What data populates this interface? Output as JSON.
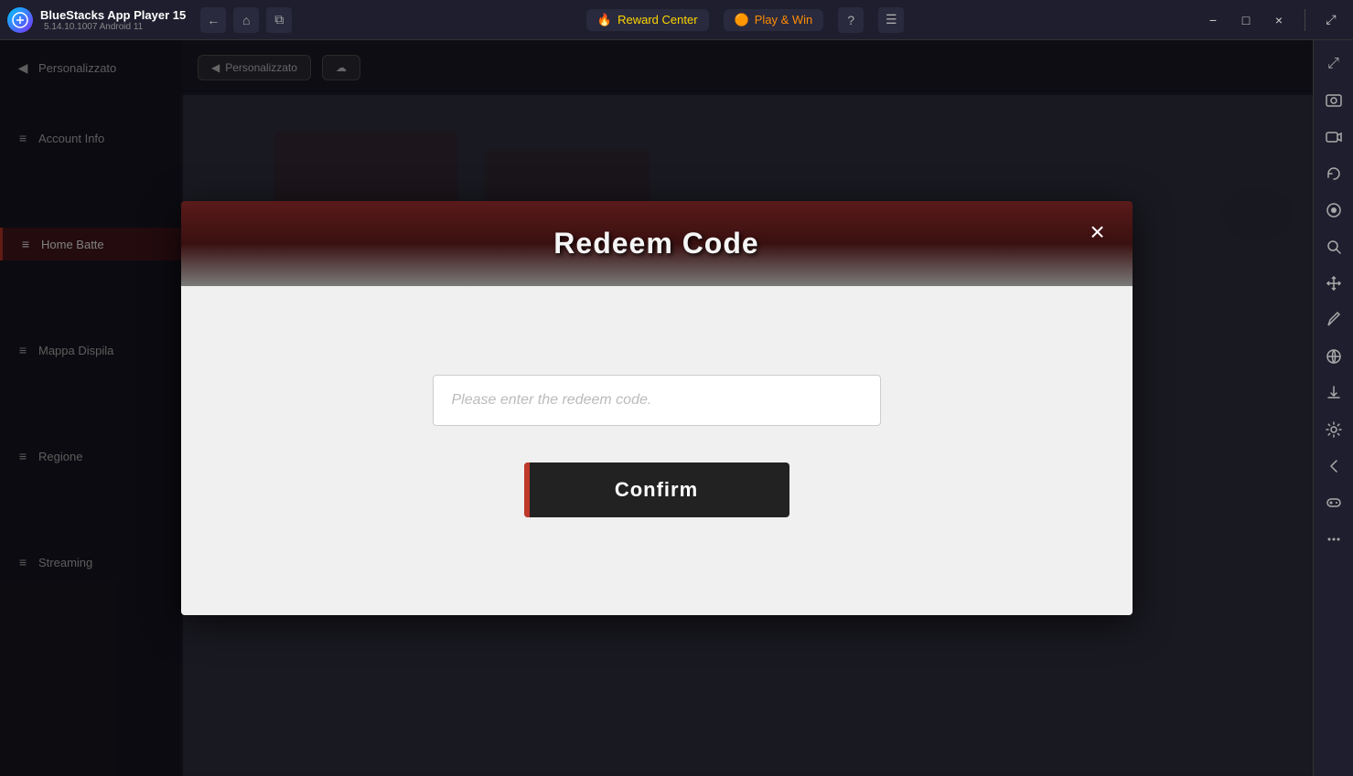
{
  "app": {
    "name": "BlueStacks App Player 15",
    "version": "5.14.10.1007  Android 11"
  },
  "titlebar": {
    "back_label": "←",
    "home_label": "⌂",
    "tabs_label": "⧉",
    "reward_center_label": "Reward Center",
    "play_win_label": "Play & Win",
    "help_label": "?",
    "menu_label": "☰",
    "minimize_label": "−",
    "maximize_label": "□",
    "close_label": "×",
    "expand_label": "⤢"
  },
  "right_sidebar": {
    "icons": [
      {
        "name": "expand-icon",
        "symbol": "⤢"
      },
      {
        "name": "screenshot-icon",
        "symbol": "📷"
      },
      {
        "name": "camera2-icon",
        "symbol": "🎥"
      },
      {
        "name": "rotate-icon",
        "symbol": "↻"
      },
      {
        "name": "record-icon",
        "symbol": "⏺"
      },
      {
        "name": "zoom-icon",
        "symbol": "🔍"
      },
      {
        "name": "move-icon",
        "symbol": "✥"
      },
      {
        "name": "edit-icon",
        "symbol": "✏"
      },
      {
        "name": "globe-icon",
        "symbol": "🌐"
      },
      {
        "name": "download-icon",
        "symbol": "⬇"
      },
      {
        "name": "settings-icon",
        "symbol": "⚙"
      },
      {
        "name": "arrow-icon",
        "symbol": "←"
      },
      {
        "name": "gamepad-icon",
        "symbol": "🎮"
      },
      {
        "name": "more-icon",
        "symbol": "···"
      }
    ]
  },
  "game": {
    "sidebar_items": [
      {
        "label": "Personalizzato",
        "active": false,
        "icon": "◀"
      },
      {
        "label": "Account Info",
        "active": false,
        "icon": "👤"
      },
      {
        "label": "Home Batte",
        "active": true,
        "icon": "≡"
      },
      {
        "label": "Mappa Dispila",
        "active": false,
        "icon": "≡"
      },
      {
        "label": "Regione",
        "active": false,
        "icon": "≡"
      },
      {
        "label": "Streaming",
        "active": false,
        "icon": "≡"
      }
    ],
    "toolbar_buttons": [
      {
        "label": "Personalizzato"
      },
      {
        "label": ""
      }
    ]
  },
  "dialog": {
    "title": "Redeem Code",
    "close_label": "×",
    "input_placeholder": "Please enter the redeem code.",
    "confirm_label": "Confirm"
  }
}
